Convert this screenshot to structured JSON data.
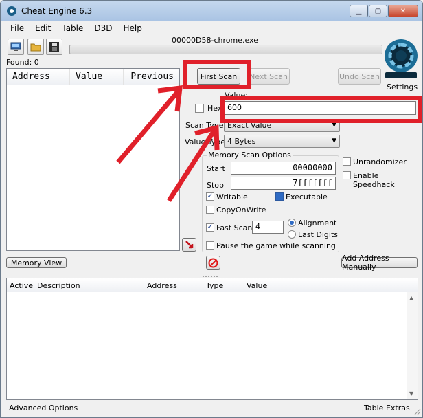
{
  "window": {
    "title": "Cheat Engine 6.3"
  },
  "menu": [
    "File",
    "Edit",
    "Table",
    "D3D",
    "Help"
  ],
  "process": {
    "name": "00000D58-chrome.exe",
    "found": "Found: 0"
  },
  "scan_list": {
    "columns": [
      "Address",
      "Value",
      "Previous"
    ]
  },
  "buttons": {
    "first_scan": "First Scan",
    "next_scan": "Next Scan",
    "undo_scan": "Undo Scan",
    "settings": "Settings",
    "memory_view": "Memory View",
    "add_address_manually": "Add Address Manually"
  },
  "scan": {
    "value_label": "Value:",
    "hex_label": "Hex",
    "value": "600",
    "scan_type_label": "Scan Type",
    "scan_type": "Exact Value",
    "value_type_label": "Value Type",
    "value_type": "4 Bytes"
  },
  "memory_options": {
    "title": "Memory Scan Options",
    "start_label": "Start",
    "start": "00000000",
    "stop_label": "Stop",
    "stop": "7fffffff",
    "writable": "Writable",
    "executable": "Executable",
    "copyonwrite": "CopyOnWrite",
    "fast_scan": "Fast Scan",
    "fast_scan_value": "4",
    "alignment": "Alignment",
    "last_digits": "Last Digits",
    "pause": "Pause the game while scanning"
  },
  "extra_options": {
    "unrandomizer": "Unrandomizer",
    "speedhack": "Enable Speedhack"
  },
  "address_list": {
    "columns": [
      "Active",
      "Description",
      "Address",
      "Type",
      "Value"
    ]
  },
  "status": {
    "advanced": "Advanced Options",
    "table_extras": "Table Extras"
  },
  "colors": {
    "annotation": "#e0202a",
    "title_bar": "#b7cde8"
  }
}
